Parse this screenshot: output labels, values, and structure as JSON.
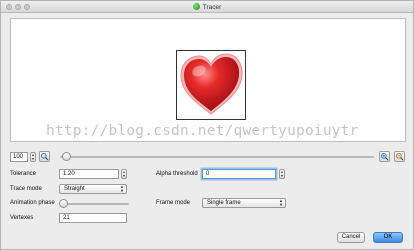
{
  "window": {
    "title": "Tracer"
  },
  "canvas": {
    "watermark": "http://blog.csdn.net/qwertyupoiuytr",
    "image": "red-heart"
  },
  "zoom": {
    "value": "100",
    "slider_level": 0.02
  },
  "form": {
    "tolerance": {
      "label": "Tolerance",
      "value": "1.20"
    },
    "trace_mode": {
      "label": "Trace mode",
      "value": "Straight"
    },
    "animation_phase": {
      "label": "Animation phase",
      "slider_level": 0.0
    },
    "vertexes": {
      "label": "Vertexes",
      "value": "21"
    },
    "alpha_threshold": {
      "label": "Alpha threshold",
      "value": "0"
    },
    "frame_mode": {
      "label": "Frame mode",
      "value": "Single frame"
    }
  },
  "buttons": {
    "cancel": "Cancel",
    "ok": "OK"
  },
  "colors": {
    "accent": "#3b8ce6",
    "heart": "#d4141c"
  }
}
